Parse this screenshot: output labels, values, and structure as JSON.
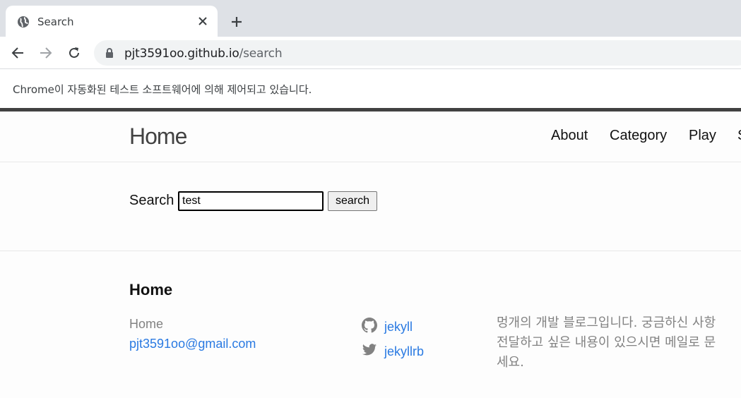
{
  "browser": {
    "tab": {
      "title": "Search",
      "favicon": "globe-icon",
      "close": "close-icon"
    },
    "new_tab": "plus-icon",
    "url": {
      "host": "pjt3591oo.github.io",
      "path": "/search"
    },
    "infobar": "Chrome이 자동화된 테스트 소프트웨어에 의해 제어되고 있습니다."
  },
  "header": {
    "site_title": "Home",
    "nav": [
      "About",
      "Category",
      "Play",
      "S"
    ]
  },
  "search": {
    "label": "Search",
    "value": "test",
    "button": "search"
  },
  "footer": {
    "heading": "Home",
    "name": "Home",
    "email": "pjt3591oo@gmail.com",
    "social": [
      {
        "icon": "github-icon",
        "label": "jekyll"
      },
      {
        "icon": "twitter-icon",
        "label": "jekyllrb"
      }
    ],
    "description_lines": [
      "멍개의 개발 블로그입니다. 궁금하신 사항",
      "전달하고 싶은 내용이 있으시면 메일로 문",
      "세요."
    ]
  }
}
